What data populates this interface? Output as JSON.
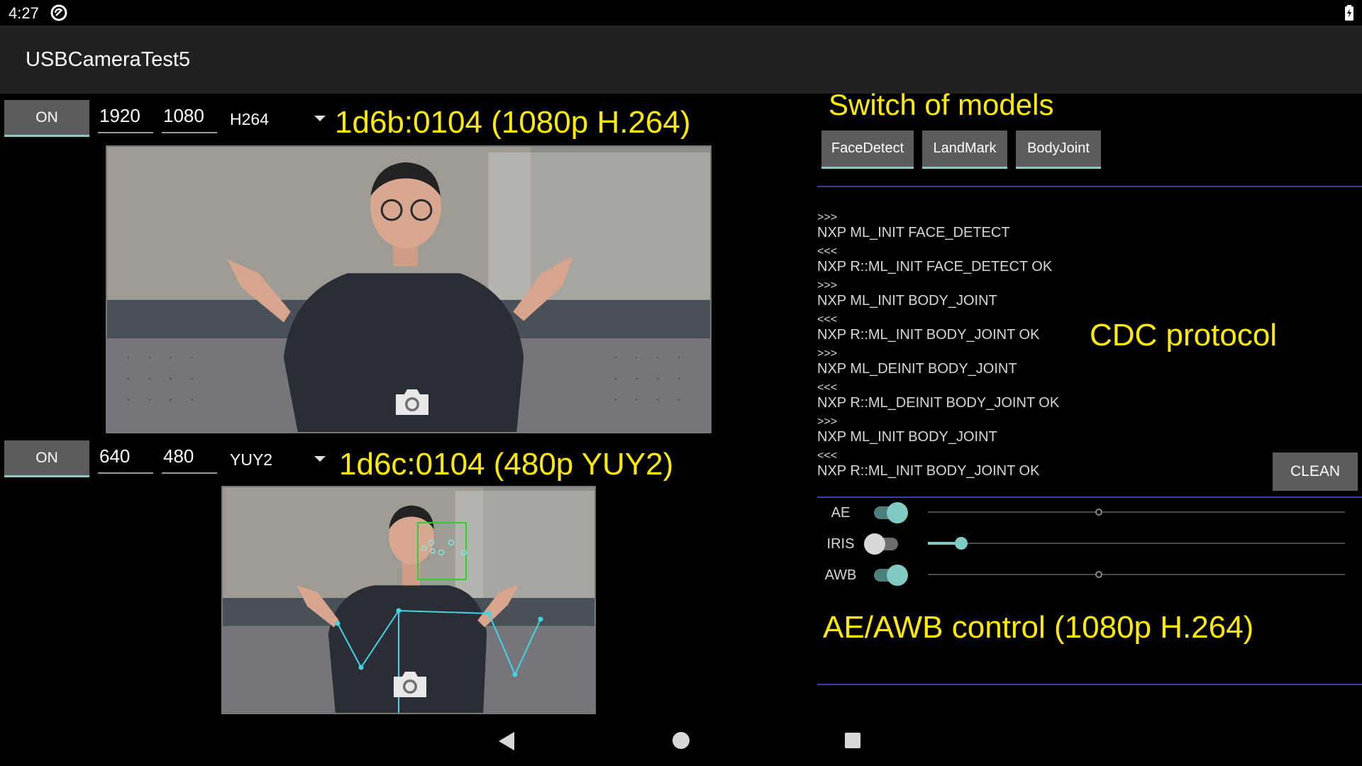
{
  "status_bar": {
    "time": "4:27",
    "icons": [
      "sync-icon",
      "battery-icon"
    ]
  },
  "app": {
    "title": "USBCameraTest5"
  },
  "camera1": {
    "on_label": "ON",
    "width": "1920",
    "height": "1080",
    "format": "H264",
    "annotation": "1d6b:0104 (1080p H.264)"
  },
  "camera2": {
    "on_label": "ON",
    "width": "640",
    "height": "480",
    "format": "YUY2",
    "annotation": "1d6c:0104 (480p YUY2)"
  },
  "models": {
    "annotation": "Switch of models",
    "buttons": [
      "FaceDetect",
      "LandMark",
      "BodyJoint"
    ]
  },
  "log": {
    "lines": [
      ">>>",
      "NXP ML_INIT FACE_DETECT",
      "<<<",
      "NXP R::ML_INIT FACE_DETECT OK",
      ">>>",
      "NXP ML_INIT BODY_JOINT",
      "<<<",
      "NXP R::ML_INIT BODY_JOINT OK",
      ">>>",
      "NXP ML_DEINIT BODY_JOINT",
      "<<<",
      "NXP R::ML_DEINIT BODY_JOINT OK",
      ">>>",
      "NXP ML_INIT BODY_JOINT",
      "<<<",
      "NXP R::ML_INIT BODY_JOINT OK"
    ],
    "annotation": "CDC protocol",
    "clean_label": "CLEAN"
  },
  "controls": {
    "ae": {
      "label": "AE",
      "enabled": true,
      "slider_level": 0.41
    },
    "iris": {
      "label": "IRIS",
      "enabled": false,
      "slider_level": 0.08
    },
    "awb": {
      "label": "AWB",
      "enabled": true,
      "slider_level": 0.41
    },
    "annotation": "AE/AWB control (1080p H.264)"
  },
  "colors": {
    "accent": "#80cbc4",
    "annotation": "#ffeb00",
    "divider": "#3a3fa8",
    "button": "#5c5c5c"
  },
  "nav": {
    "icons": [
      "back-icon",
      "home-icon",
      "recents-icon"
    ]
  }
}
